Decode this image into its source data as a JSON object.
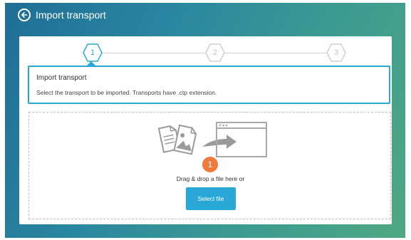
{
  "header": {
    "title": "Import transport"
  },
  "stepper": {
    "steps": [
      {
        "number": "1",
        "state": "active"
      },
      {
        "number": "2",
        "state": "inactive"
      },
      {
        "number": "3",
        "state": "inactive"
      }
    ]
  },
  "info": {
    "title": "Import transport",
    "description": "Select the transport to be imported. Transports have .ctp extension."
  },
  "dropzone": {
    "badge": "1",
    "text": "Drag & drop a file here or",
    "button_label": "Select file"
  },
  "colors": {
    "accent": "#29a8d8",
    "badge": "#ef7a3c",
    "gradient_start": "#1f6e96",
    "gradient_end": "#4fa882"
  },
  "icons": [
    "back-arrow-icon",
    "documents-icon",
    "arrow-right-icon",
    "browser-window-icon"
  ]
}
